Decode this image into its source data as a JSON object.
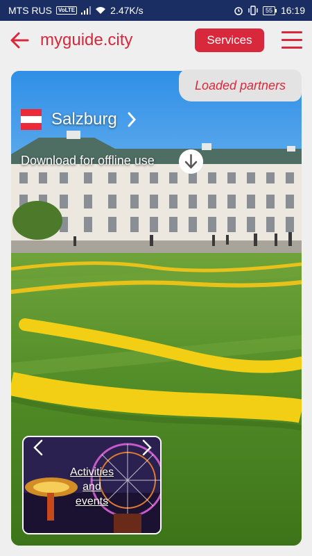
{
  "status_bar": {
    "carrier": "MTS RUS",
    "network_badge": "VoLTE",
    "speed": "2.47K/s",
    "battery": "55",
    "time": "16:19",
    "icons": [
      "signal-icon",
      "wifi-icon",
      "alarm-icon",
      "vibrate-icon",
      "battery-icon"
    ]
  },
  "app_bar": {
    "brand": "myguide.city",
    "services_label": "Services",
    "back_icon": "arrow-left-icon",
    "menu_icon": "hamburger-menu-icon"
  },
  "hero": {
    "partners_badge": "Loaded partners",
    "city": "Salzburg",
    "download_label": "Download for offline use",
    "flag_colors": [
      "#ed2939",
      "#ffffff",
      "#ed2939"
    ]
  },
  "activities_card": {
    "line1": "Activities",
    "line2": "and",
    "line3": "events"
  },
  "colors": {
    "accent": "#d8283b",
    "status_bar": "#1a2e63",
    "background": "#efefef"
  }
}
